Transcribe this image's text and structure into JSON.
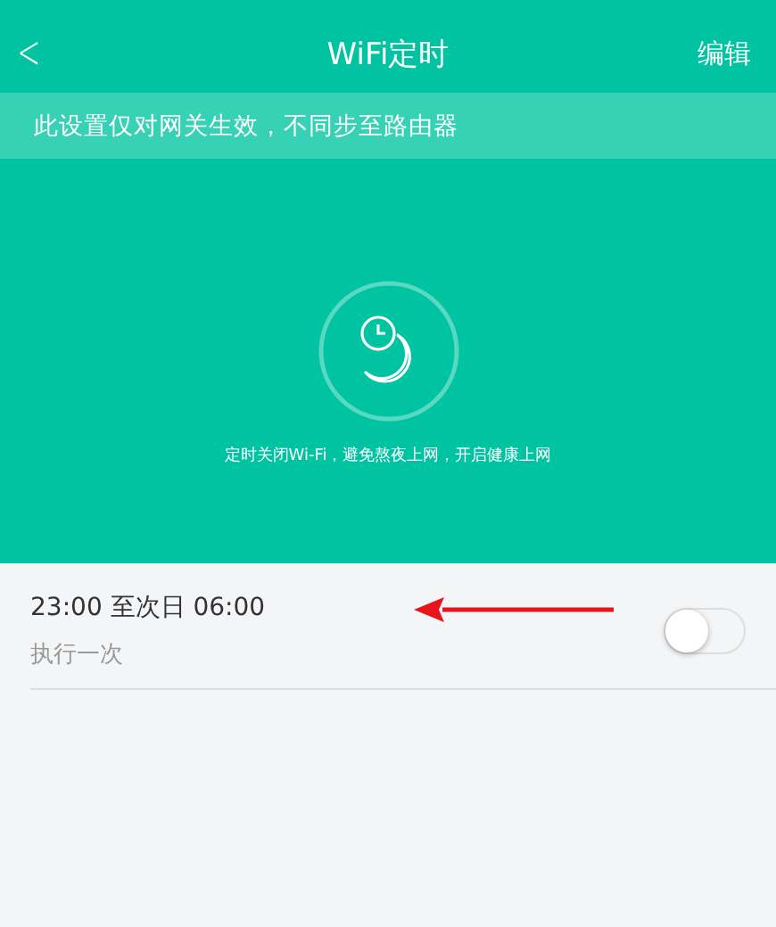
{
  "nav_bar": {
    "back": "<",
    "title": "WiFi定时",
    "action": "编辑"
  },
  "notice": "此设置仅对网关生效，不同步至路由器",
  "hero": {
    "caption": "定时关闭Wi-Fi，避免熬夜上网，开启健康上网"
  },
  "schedules": [
    {
      "time": "23:00 至次日 06:00",
      "repeat": "执行一次",
      "on": false
    }
  ]
}
